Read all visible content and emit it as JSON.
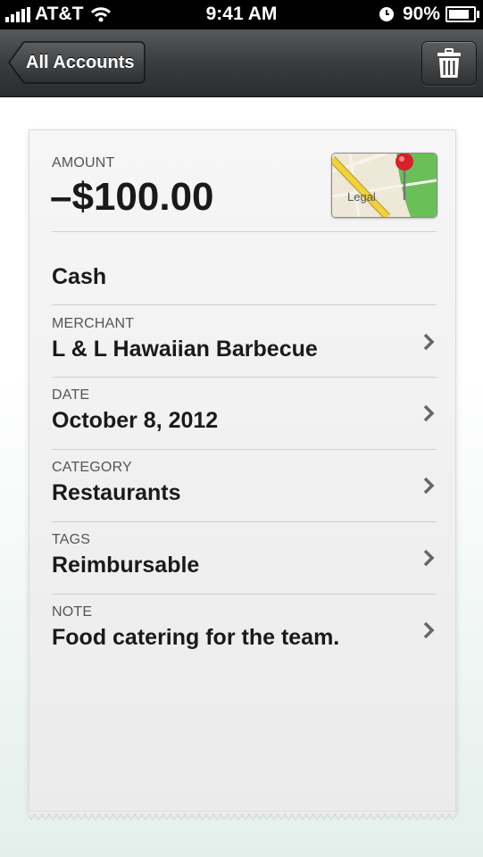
{
  "status_bar": {
    "carrier": "AT&T",
    "time": "9:41 AM",
    "battery": "90%",
    "icons": [
      "signal-bars-icon",
      "wifi-icon",
      "clock-icon",
      "battery-icon"
    ]
  },
  "nav": {
    "back_label": "All Accounts",
    "trash_icon": "trash-icon"
  },
  "transaction": {
    "amount_label": "AMOUNT",
    "amount": "–$100.00",
    "map_label": "Legal",
    "account": "Cash",
    "rows": [
      {
        "label": "MERCHANT",
        "value": "L & L Hawaiian Barbecue"
      },
      {
        "label": "DATE",
        "value": "October 8, 2012"
      },
      {
        "label": "CATEGORY",
        "value": "Restaurants"
      },
      {
        "label": "TAGS",
        "value": "Reimbursable"
      },
      {
        "label": "NOTE",
        "value": "Food catering for the team."
      }
    ]
  },
  "colors": {
    "navbar": "#3a3c3e",
    "card": "#f0f0f0",
    "map_pin": "#d8202a",
    "map_road": "#e9c52e",
    "map_park": "#6bbf59"
  }
}
